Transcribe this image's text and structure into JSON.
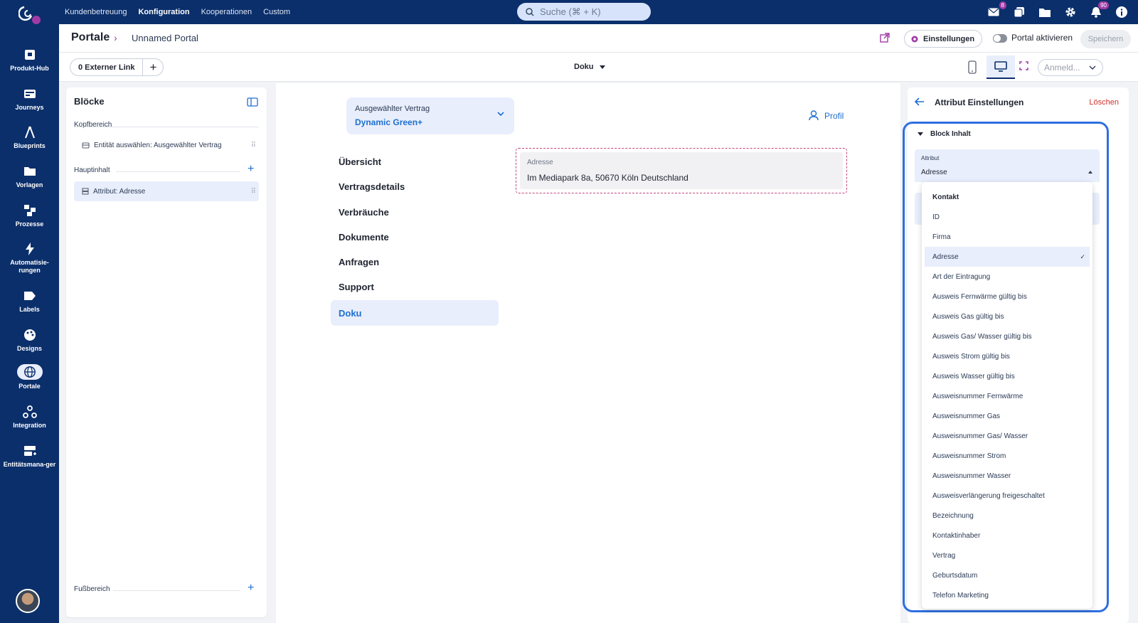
{
  "topbar": {
    "nav": [
      "Kundenbetreuung",
      "Konfiguration",
      "Kooperationen",
      "Custom"
    ],
    "active_nav": "Konfiguration",
    "search_placeholder": "Suche (⌘ + K)",
    "mail_badge": "8",
    "notif_badge": "90",
    "icons": [
      "mail-icon",
      "copy-icon",
      "folder-icon",
      "gear-icon",
      "bell-icon",
      "info-icon"
    ]
  },
  "sidebar": {
    "items": [
      {
        "label": "Produkt-Hub",
        "icon": "store-icon"
      },
      {
        "label": "Journeys",
        "icon": "journey-icon"
      },
      {
        "label": "Blueprints",
        "icon": "compass-icon"
      },
      {
        "label": "Vorlagen",
        "icon": "folder-icon"
      },
      {
        "label": "Prozesse",
        "icon": "process-icon"
      },
      {
        "label": "Automatisie-rungen",
        "icon": "bolt-icon"
      },
      {
        "label": "Labels",
        "icon": "label-icon"
      },
      {
        "label": "Designs",
        "icon": "palette-icon"
      },
      {
        "label": "Portale",
        "icon": "globe-icon"
      },
      {
        "label": "Integration",
        "icon": "webhook-icon"
      },
      {
        "label": "Entitätsmana-ger",
        "icon": "entity-icon"
      }
    ],
    "active": "Portale"
  },
  "header": {
    "title": "Portale",
    "breadcrumb": "Unnamed Portal",
    "settings_label": "Einstellungen",
    "toggle_label": "Portal aktivieren",
    "save_label": "Speichern"
  },
  "subheader": {
    "ext_link_label": "0 Externer Link",
    "page_select": "Doku",
    "login_select": "Anmeld..."
  },
  "blocks": {
    "title": "Blöcke",
    "sections": {
      "kopf": "Kopfbereich",
      "haupt": "Hauptinhalt",
      "fuss": "Fußbereich"
    },
    "kopf_items": [
      "Entität auswählen: Ausgewählter Vertrag"
    ],
    "haupt_items": [
      "Attribut: Adresse"
    ]
  },
  "canvas": {
    "vertrag_label": "Ausgewählter Vertrag",
    "vertrag_value": "Dynamic Green+",
    "profil": "Profil",
    "menu": [
      "Übersicht",
      "Vertragsdetails",
      "Verbräuche",
      "Dokumente",
      "Anfragen",
      "Support",
      "Doku"
    ],
    "active_menu": "Doku",
    "address_label": "Adresse",
    "address_value": "Im Mediapark 8a, 50670 Köln Deutschland"
  },
  "right_panel": {
    "title": "Attribut Einstellungen",
    "delete_label": "Löschen",
    "section": "Block Inhalt",
    "attr_label": "Attribut",
    "attr_value": "Adresse",
    "options_header": "Kontakt",
    "options": [
      "ID",
      "Firma",
      "Adresse",
      "Art der Eintragung",
      "Ausweis Fernwärme gültig bis",
      "Ausweis Gas gültig bis",
      "Ausweis Gas/ Wasser gültig bis",
      "Ausweis Strom gültig bis",
      "Ausweis Wasser gültig bis",
      "Ausweisnummer Fernwärme",
      "Ausweisnummer Gas",
      "Ausweisnummer Gas/ Wasser",
      "Ausweisnummer Strom",
      "Ausweisnummer Wasser",
      "Ausweisverlängerung freigeschaltet",
      "Bezeichnung",
      "Kontaktinhaber",
      "Vertrag",
      "Geburtsdatum",
      "Telefon Marketing"
    ],
    "selected_option": "Adresse"
  },
  "colors": {
    "nav_bg": "#0b2f6b",
    "accent": "#1f6fd0",
    "highlight_bg": "#e8eefb",
    "brand_purple": "#a23aa6",
    "danger": "#d0332d",
    "focus_frame": "#2f6fe0"
  }
}
